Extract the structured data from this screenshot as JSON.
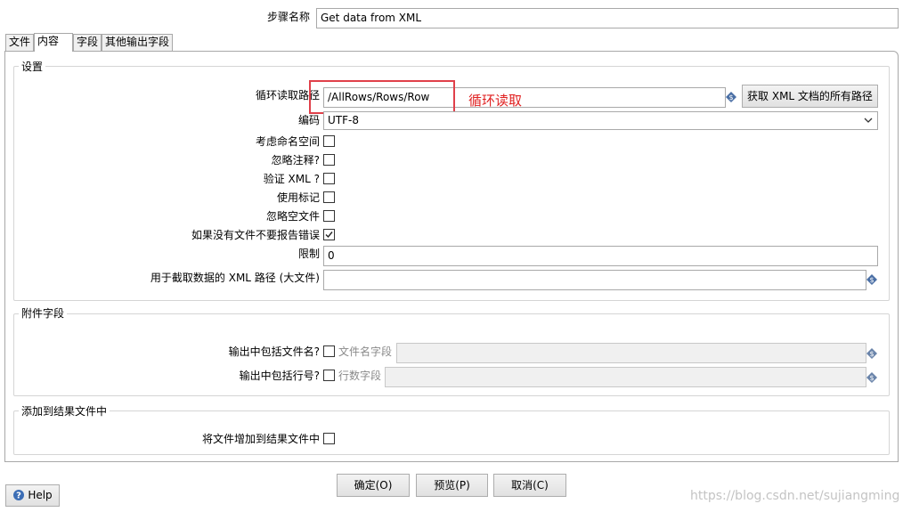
{
  "step": {
    "label": "步骤名称",
    "value": "Get data from XML"
  },
  "tabs": [
    "文件",
    "内容",
    "字段",
    "其他输出字段"
  ],
  "settings": {
    "title": "设置",
    "loop_path_label": "循环读取路径",
    "loop_path_value": "/AllRows/Rows/Row",
    "annotation": "循环读取",
    "get_paths_button": "获取 XML 文档的所有路径",
    "encoding_label": "编码",
    "encoding_value": "UTF-8",
    "namespace_label": "考虑命名空间",
    "ignore_comments_label": "忽略注释?",
    "validate_label": "验证 XML ?",
    "use_token_label": "使用标记",
    "ignore_empty_label": "忽略空文件",
    "no_error_label": "如果没有文件不要报告错误",
    "limit_label": "限制",
    "limit_value": "0",
    "prune_label": "用于截取数据的 XML 路径 (大文件)",
    "prune_value": ""
  },
  "checkbox_states": {
    "namespace": false,
    "ignore_comments": false,
    "validate": false,
    "use_token": false,
    "ignore_empty": false,
    "no_error": true
  },
  "additional": {
    "title": "附件字段",
    "include_filename_label": "输出中包括文件名?",
    "filename_field_label": "文件名字段",
    "include_rownum_label": "输出中包括行号?",
    "rownum_field_label": "行数字段"
  },
  "result": {
    "title": "添加到结果文件中",
    "add_label": "将文件增加到结果文件中"
  },
  "footer": {
    "ok": "确定(O)",
    "preview": "预览(P)",
    "cancel": "取消(C)",
    "help": "Help"
  },
  "watermark": "https://blog.csdn.net/sujiangming",
  "colors": {
    "annotation": "#e02020",
    "variable_icon": "#4a6fa5"
  }
}
